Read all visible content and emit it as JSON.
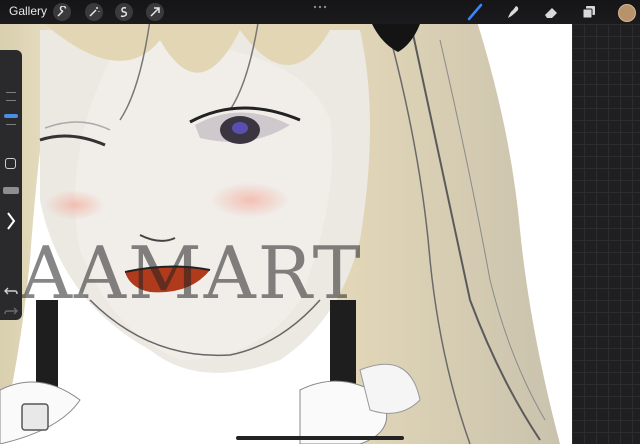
{
  "toolbar": {
    "gallery_label": "Gallery",
    "left_tools": [
      "wrench-icon",
      "magic-wand-icon",
      "selection-icon",
      "transform-arrow-icon"
    ],
    "right_tools": [
      "brush-icon",
      "smudge-icon",
      "eraser-icon",
      "layers-icon"
    ],
    "active_tool": "brush-icon",
    "current_color": "#b7926b"
  },
  "sidebar": {
    "tools": [
      "brush-size-slider",
      "modify-button",
      "opacity-slider",
      "collapse-chevron",
      "undo-icon",
      "redo-icon"
    ]
  },
  "canvas": {
    "watermark": "AAMART"
  }
}
